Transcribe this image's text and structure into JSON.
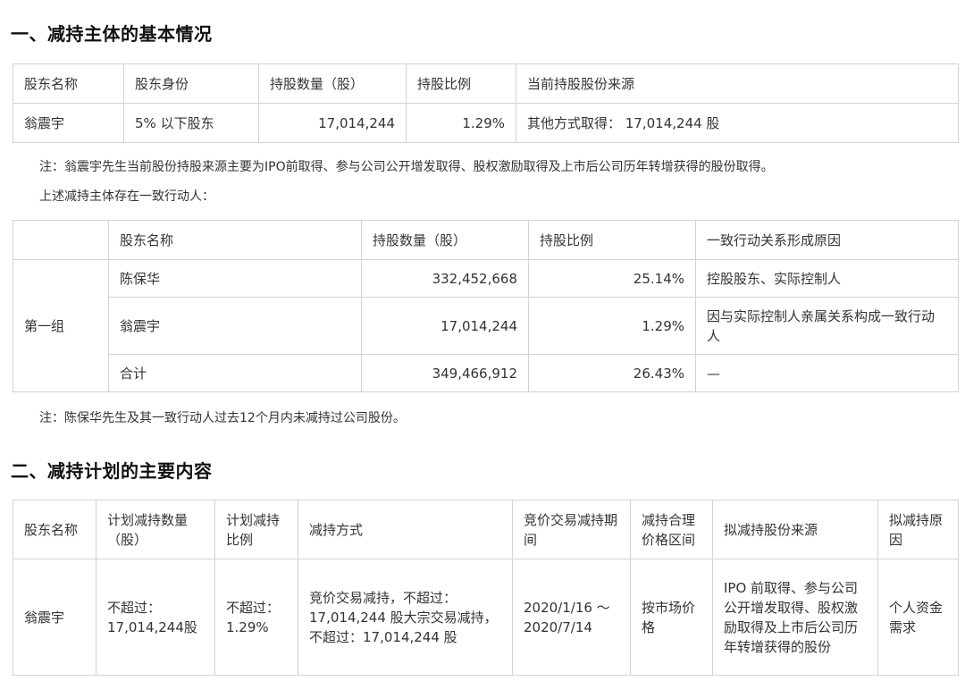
{
  "section1": {
    "title": "一、减持主体的基本情况",
    "table": {
      "headers": [
        "股东名称",
        "股东身份",
        "持股数量（股）",
        "持股比例",
        "当前持股股份来源"
      ],
      "rows": [
        [
          "翁震宇",
          "5% 以下股东",
          "17,014,244",
          "1.29%",
          "其他方式取得： 17,014,244 股"
        ]
      ]
    },
    "note1": "注：翁震宇先生当前股份持股来源主要为IPO前取得、参与公司公开增发取得、股权激励取得及上市后公司历年转增获得的股份取得。",
    "note2": "上述减持主体存在一致行动人：",
    "group_table": {
      "headers": [
        "",
        "股东名称",
        "持股数量（股）",
        "持股比例",
        "一致行动关系形成原因"
      ],
      "group_label": "第一组",
      "rows": [
        [
          "陈保华",
          "332,452,668",
          "25.14%",
          "控股股东、实际控制人"
        ],
        [
          "翁震宇",
          "17,014,244",
          "1.29%",
          "因与实际控制人亲属关系构成一致行动人"
        ],
        [
          "合计",
          "349,466,912",
          "26.43%",
          "—"
        ]
      ]
    },
    "note3": "注：陈保华先生及其一致行动人过去12个月内未减持过公司股份。"
  },
  "section2": {
    "title": "二、减持计划的主要内容",
    "table": {
      "headers": [
        "股东名称",
        "计划减持数量（股）",
        "计划减持比例",
        "减持方式",
        "竞价交易减持期间",
        "减持合理价格区间",
        "拟减持股份来源",
        "拟减持原因"
      ],
      "row": [
        "翁震宇",
        "不超过：17,014,244股",
        "不超过：1.29%",
        "竞价交易减持，不超过：17,014,244 股大宗交易减持，不超过：17,014,244 股",
        "2020/1/16 ～ 2020/7/14",
        "按市场价格",
        "IPO 前取得、参与公司公开增发取得、股权激励取得及上市后公司历年转增获得的股份",
        "个人资金需求"
      ]
    }
  }
}
